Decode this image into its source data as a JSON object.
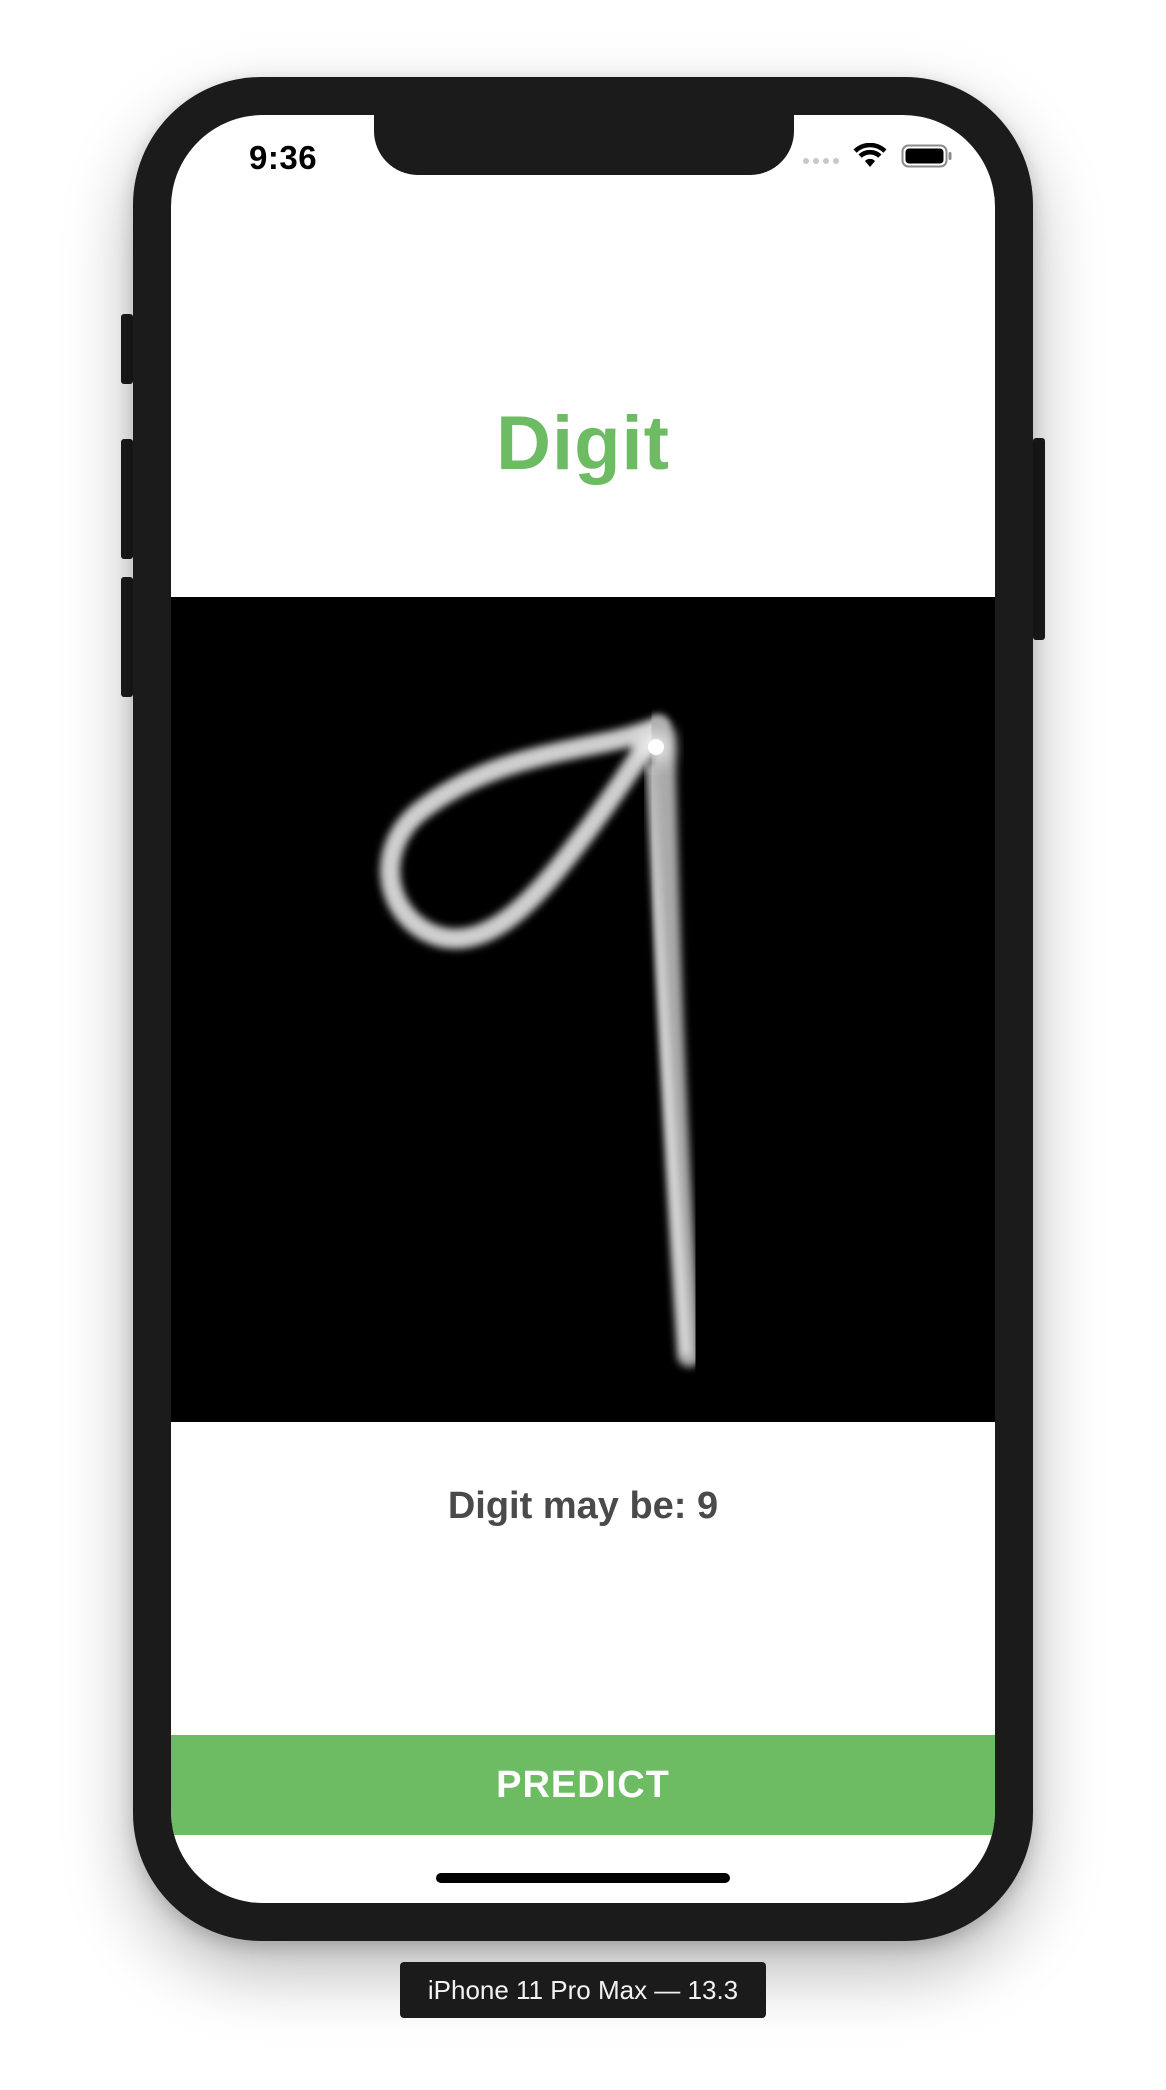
{
  "status_bar": {
    "time": "9:36"
  },
  "app": {
    "title": "Digit",
    "prediction_label": "Digit may be: 9",
    "predict_button_label": "PREDICT"
  },
  "drawing": {
    "digit_drawn": "9"
  },
  "device": {
    "label": "iPhone 11 Pro Max — 13.3"
  },
  "colors": {
    "accent": "#6dbb62",
    "text_secondary": "#4a4a4a",
    "canvas_background": "#000000",
    "frame": "#1b1b1b"
  },
  "icons": [
    "signal-dots-icon",
    "wifi-icon",
    "battery-icon"
  ]
}
